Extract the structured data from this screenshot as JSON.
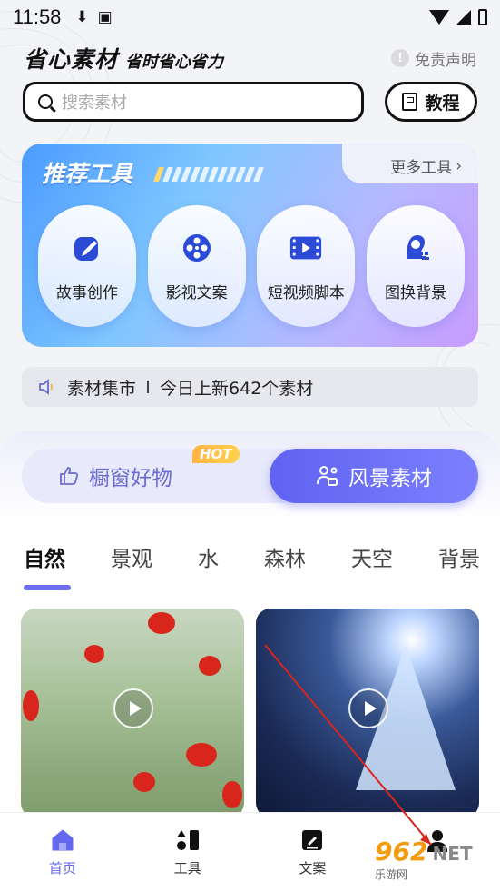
{
  "status_bar": {
    "time": "11:58"
  },
  "header": {
    "logo_main": "省心素材",
    "logo_sub": "省时省心省力",
    "disclaimer": "免责声明"
  },
  "search": {
    "placeholder": "搜索素材"
  },
  "tutorial": {
    "label": "教程"
  },
  "tools": {
    "title": "推荐工具",
    "more": "更多工具",
    "items": [
      {
        "label": "故事创作",
        "icon": "pen-edit-icon"
      },
      {
        "label": "影视文案",
        "icon": "film-reel-icon"
      },
      {
        "label": "短视频脚本",
        "icon": "video-icon"
      },
      {
        "label": "图换背景",
        "icon": "person-background-icon"
      }
    ]
  },
  "market": {
    "title": "素材集市",
    "notice": "今日上新642个素材"
  },
  "switch_tabs": {
    "left": "橱窗好物",
    "hot": "HOT",
    "right": "风景素材"
  },
  "categories": [
    "自然",
    "景观",
    "水",
    "森林",
    "天空",
    "背景"
  ],
  "active_category": "自然",
  "bottom_nav": [
    {
      "label": "首页",
      "icon": "home-icon",
      "active": true
    },
    {
      "label": "工具",
      "icon": "tools-icon",
      "active": false
    },
    {
      "label": "文案",
      "icon": "document-icon",
      "active": false
    },
    {
      "label": "",
      "icon": "profile-icon",
      "active": false
    }
  ],
  "watermark": {
    "number": "962",
    "net": "NET",
    "sub": "乐游网"
  },
  "colors": {
    "accent": "#6567ef",
    "hot": "#ffb347"
  }
}
